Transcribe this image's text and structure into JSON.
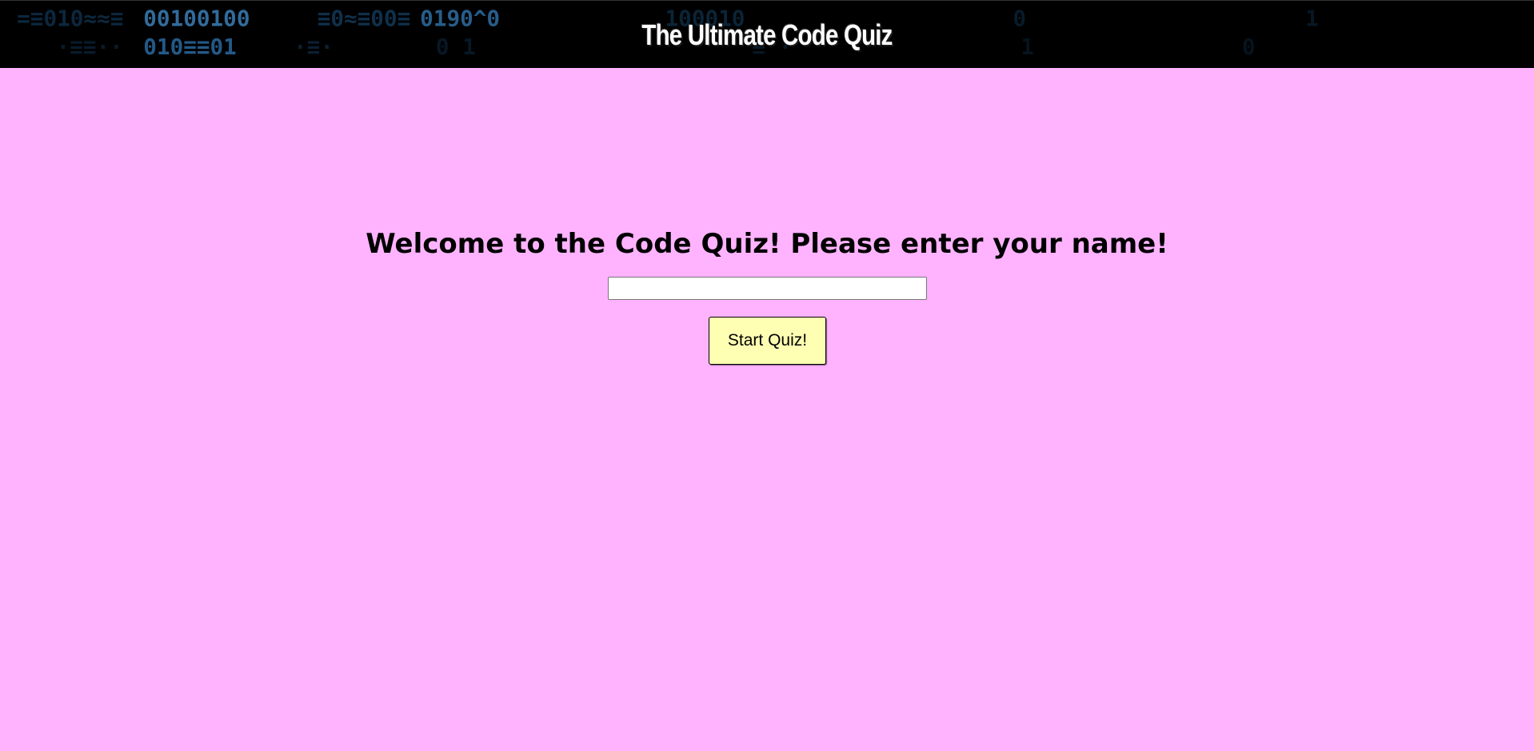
{
  "header": {
    "title": "The Ultimate Code Quiz",
    "background_color": "#000000",
    "binary_color": "#2a6fa8"
  },
  "main": {
    "background_color": "#ffb3ff",
    "welcome_text": "Welcome to the Code Quiz! Please enter your name!",
    "name_input": {
      "value": "",
      "placeholder": ""
    },
    "start_button_label": "Start Quiz!",
    "start_button_color": "#ffffb3"
  }
}
